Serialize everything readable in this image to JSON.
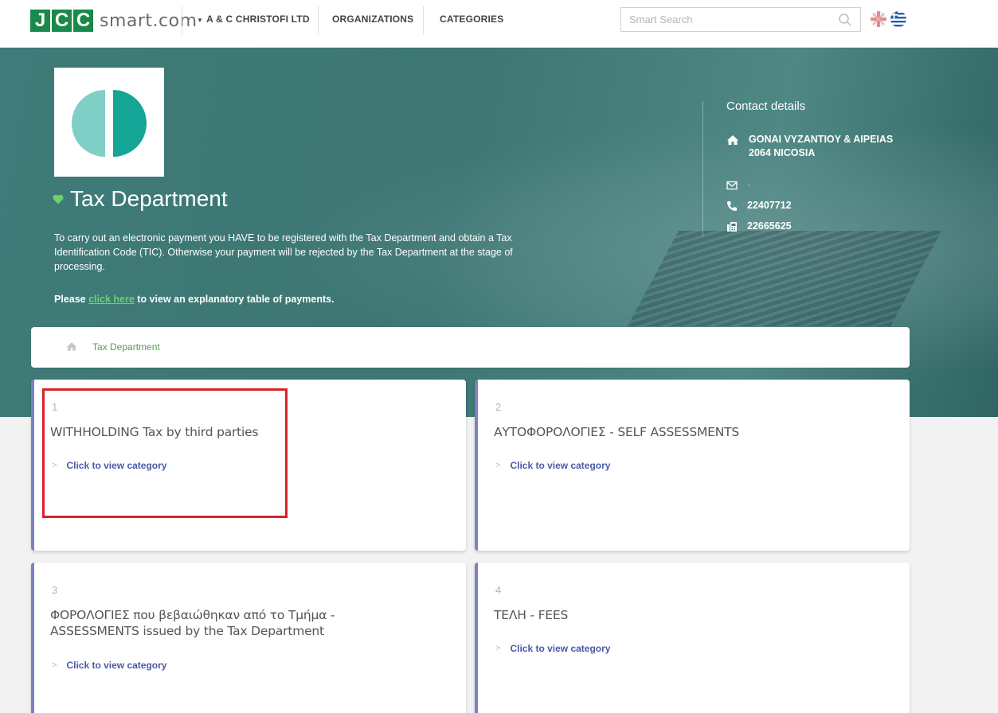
{
  "header": {
    "logo_letters": [
      "J",
      "C",
      "C"
    ],
    "logo_text": "smart.com",
    "account_label": "A & C CHRISTOFI LTD",
    "nav": [
      "ORGANIZATIONS",
      "CATEGORIES"
    ],
    "search_placeholder": "Smart Search",
    "languages": [
      "english-flag-icon",
      "greek-flag-icon"
    ]
  },
  "organization": {
    "name": "Tax Department",
    "description": "To carry out an electronic payment you HAVE to be registered with the Tax Department and obtain a Tax Identification Code (TIC). Otherwise your payment will be rejected by the Tax Department at the stage of processing.",
    "please_prefix": "Please",
    "link_text": "click here",
    "please_suffix": "to view an explanatory table of payments."
  },
  "contact": {
    "title": "Contact details",
    "address_line1": "GONAI VYZANTIOY & AIPEIAS",
    "address_line2": "2064 NICOSIA",
    "email": "-",
    "phone": "22407712",
    "fax": "22665625"
  },
  "breadcrumb": {
    "item": "Tax Department"
  },
  "categories": [
    {
      "number": "1",
      "title": "WITHHOLDING Tax by third parties",
      "link": "Click to view category"
    },
    {
      "number": "2",
      "title": "ΑΥΤΟΦΟΡΟΛΟΓΙΕΣ - SELF ASSESSMENTS",
      "link": "Click to view category"
    },
    {
      "number": "3",
      "title_line1": "ΦΟΡΟΛΟΓΙΕΣ που βεβαιώθηκαν από το Τμήμα -",
      "title_line2": "ASSESSMENTS issued by the Tax Department",
      "link": "Click to view category"
    },
    {
      "number": "4",
      "title": "ΤΕΛΗ - FEES",
      "link": "Click to view category"
    }
  ],
  "colors": {
    "brand_green": "#1a8a4a",
    "link_green": "#6ad26a",
    "card_accent": "#7b81c2",
    "highlight_red": "#d8232a"
  }
}
